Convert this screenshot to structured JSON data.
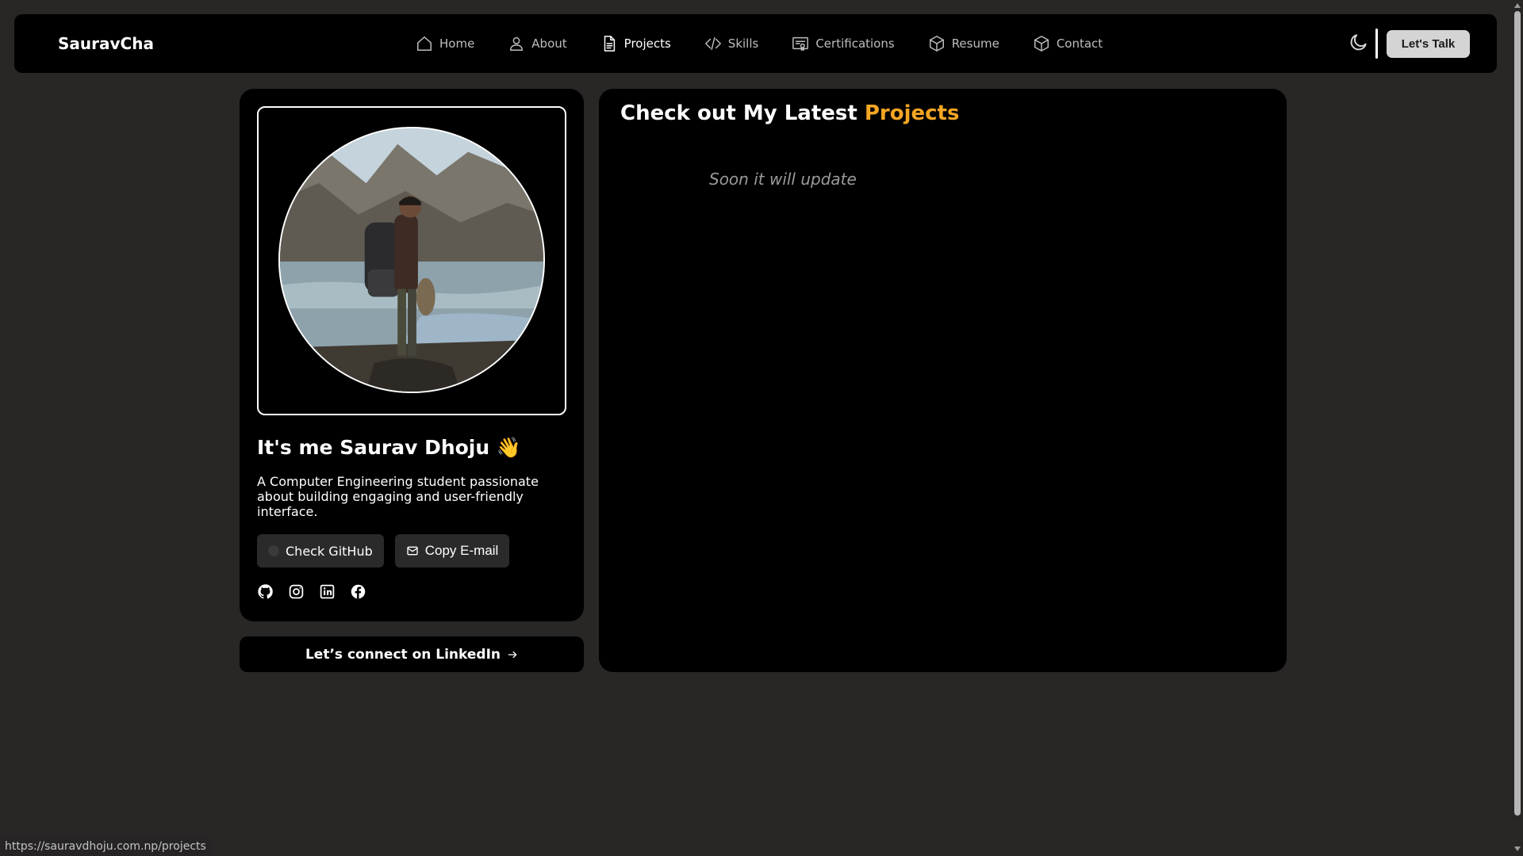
{
  "navbar": {
    "brand": "SauravCha",
    "links": [
      {
        "label": "Home",
        "icon": "home-icon"
      },
      {
        "label": "About",
        "icon": "user-icon"
      },
      {
        "label": "Projects",
        "icon": "document-icon",
        "active": true
      },
      {
        "label": "Skills",
        "icon": "code-icon"
      },
      {
        "label": "Certifications",
        "icon": "certificate-icon"
      },
      {
        "label": "Resume",
        "icon": "package-icon"
      },
      {
        "label": "Contact",
        "icon": "package-icon"
      }
    ],
    "theme_toggle_icon": "moon-icon",
    "cta_label": "Let's Talk"
  },
  "profile": {
    "name": "It's me Saurav Dhoju 👋",
    "bio": "A Computer Engineering student passionate about building engaging and user-friendly interface.",
    "github_button": "Check GitHub",
    "email_button": "Copy E-mail",
    "socials": [
      "github-icon",
      "instagram-icon",
      "linkedin-icon",
      "facebook-icon"
    ]
  },
  "linkedin_cta": "Let’s connect on LinkedIn",
  "projects": {
    "title_prefix": "Check out My Latest ",
    "title_accent": "Projects",
    "empty_message": "Soon it will update"
  },
  "status_url": "https://sauravdhoju.com.np/projects",
  "colors": {
    "page_bg": "#292626",
    "card_bg": "#000000",
    "accent": "#f5a623",
    "cta_bg": "#d4d4d4"
  }
}
